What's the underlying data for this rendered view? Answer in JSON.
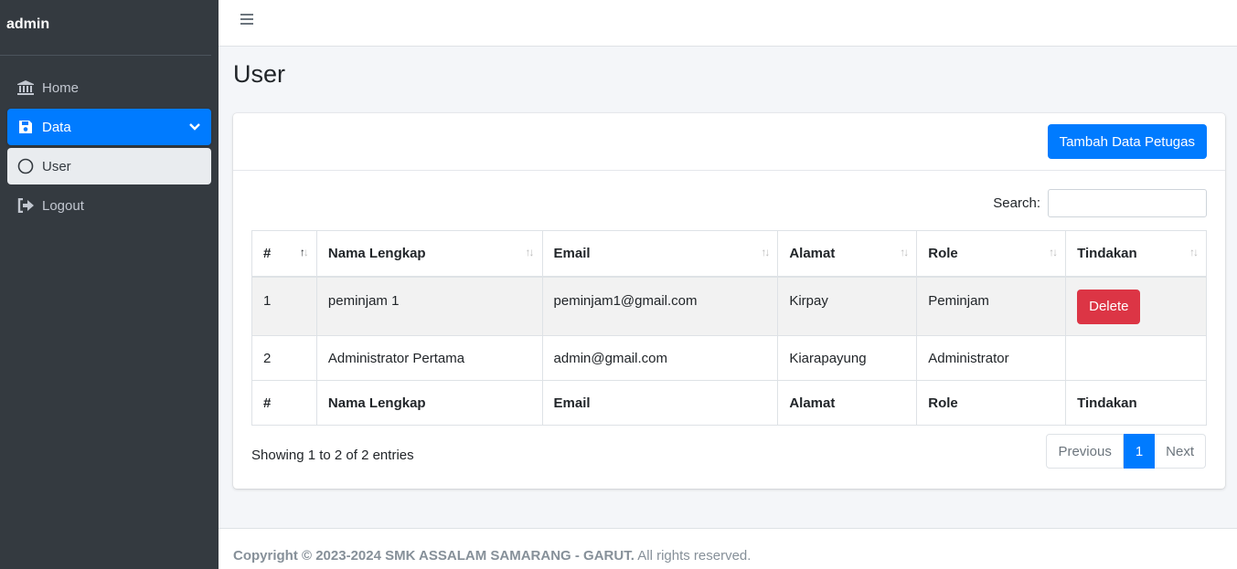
{
  "sidebar": {
    "brand": "admin",
    "items": [
      {
        "label": "Home",
        "icon": "bank-icon"
      },
      {
        "label": "Data",
        "icon": "save-icon"
      },
      {
        "label": "User",
        "icon": "circle-icon"
      },
      {
        "label": "Logout",
        "icon": "sign-out-icon"
      }
    ]
  },
  "page": {
    "title": "User"
  },
  "card": {
    "add_button": "Tambah Data Petugas",
    "search_label": "Search:",
    "search_value": ""
  },
  "table": {
    "columns": [
      "#",
      "Nama Lengkap",
      "Email",
      "Alamat",
      "Role",
      "Tindakan"
    ],
    "rows": [
      {
        "no": "1",
        "nama": "peminjam 1",
        "email": "peminjam1@gmail.com",
        "alamat": "Kirpay",
        "role": "Peminjam",
        "action": "Delete"
      },
      {
        "no": "2",
        "nama": "Administrator Pertama",
        "email": "admin@gmail.com",
        "alamat": "Kiarapayung",
        "role": "Administrator",
        "action": ""
      }
    ]
  },
  "pagination": {
    "info": "Showing 1 to 2 of 2 entries",
    "previous": "Previous",
    "current": "1",
    "next": "Next"
  },
  "footer": {
    "copyright": "Copyright © 2023-2024 SMK ASSALAM SAMARANG - GARUT.",
    "rights": " All rights reserved."
  },
  "colors": {
    "primary": "#007bff",
    "danger": "#dc3545",
    "sidebar": "#343a40"
  }
}
